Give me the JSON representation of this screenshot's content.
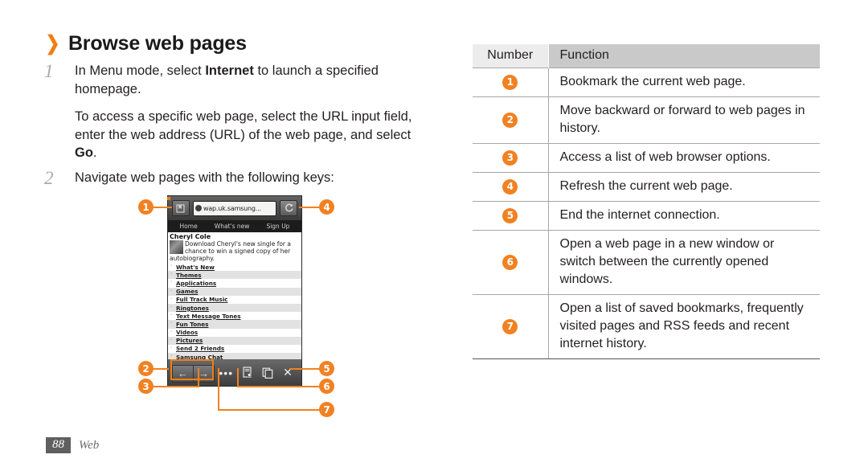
{
  "heading": {
    "chevron_icon": "chevron-right-icon",
    "title": "Browse web pages"
  },
  "steps": [
    {
      "number": "1",
      "paragraphs": [
        "In Menu mode, select <b>Internet</b> to launch a specified homepage.",
        "To access a specific web page, select the URL input field, enter the web address (URL) of the web page, and select <b>Go</b>."
      ]
    },
    {
      "number": "2",
      "paragraphs": [
        "Navigate web pages with the following keys:"
      ]
    }
  ],
  "phone": {
    "bookmark_icon": "bookmark-page-icon",
    "url_value": "wap.uk.samsung...",
    "url_globe_icon": "globe-icon",
    "refresh_icon": "refresh-icon",
    "site_nav": [
      "Home",
      "What's new",
      "Sign Up"
    ],
    "article_title": "Cheryl Cole",
    "article_text": "Download Cheryl's new single for a chance to win a signed copy of her autobiography.",
    "links": [
      "What's New",
      "Themes",
      "Applications",
      "Games",
      "Full Track Music",
      "Ringtones",
      "Text Message Tones",
      "Fun Tones",
      "Videos",
      "Pictures",
      "Send 2 Friends",
      "Samsung Chat"
    ],
    "toolbar": {
      "back_icon": "arrow-left-icon",
      "forward_icon": "arrow-right-icon",
      "options_icon": "more-options-icon",
      "options_label": "•••",
      "bookmarks_icon": "bookmark-star-icon",
      "windows_icon": "windows-icon",
      "close_icon": "close-x-icon",
      "close_label": "✕"
    }
  },
  "callouts": [
    {
      "n": "1"
    },
    {
      "n": "2"
    },
    {
      "n": "3"
    },
    {
      "n": "4"
    },
    {
      "n": "5"
    },
    {
      "n": "6"
    },
    {
      "n": "7"
    }
  ],
  "table": {
    "headers": {
      "number": "Number",
      "function": "Function"
    },
    "rows": [
      {
        "number": "1",
        "function": "Bookmark the current web page."
      },
      {
        "number": "2",
        "function": "Move backward or forward to web pages in history."
      },
      {
        "number": "3",
        "function": "Access a list of web browser options."
      },
      {
        "number": "4",
        "function": "Refresh the current web page."
      },
      {
        "number": "5",
        "function": "End the internet connection."
      },
      {
        "number": "6",
        "function": "Open a web page in a new window or switch between the currently opened windows."
      },
      {
        "number": "7",
        "function": "Open a list of saved bookmarks, frequently visited pages and RSS feeds and recent internet history."
      }
    ]
  },
  "footer": {
    "page_number": "88",
    "label": "Web"
  },
  "colors": {
    "accent_orange": "#F18121",
    "heading_chevron": "#F07F13",
    "table_header_number_bg": "#ececec",
    "table_header_function_bg": "#c9c9c9",
    "table_rule": "#a7a7a7",
    "footer_badge_bg": "#5f5f5f",
    "step_number": "#a9a9a9"
  }
}
